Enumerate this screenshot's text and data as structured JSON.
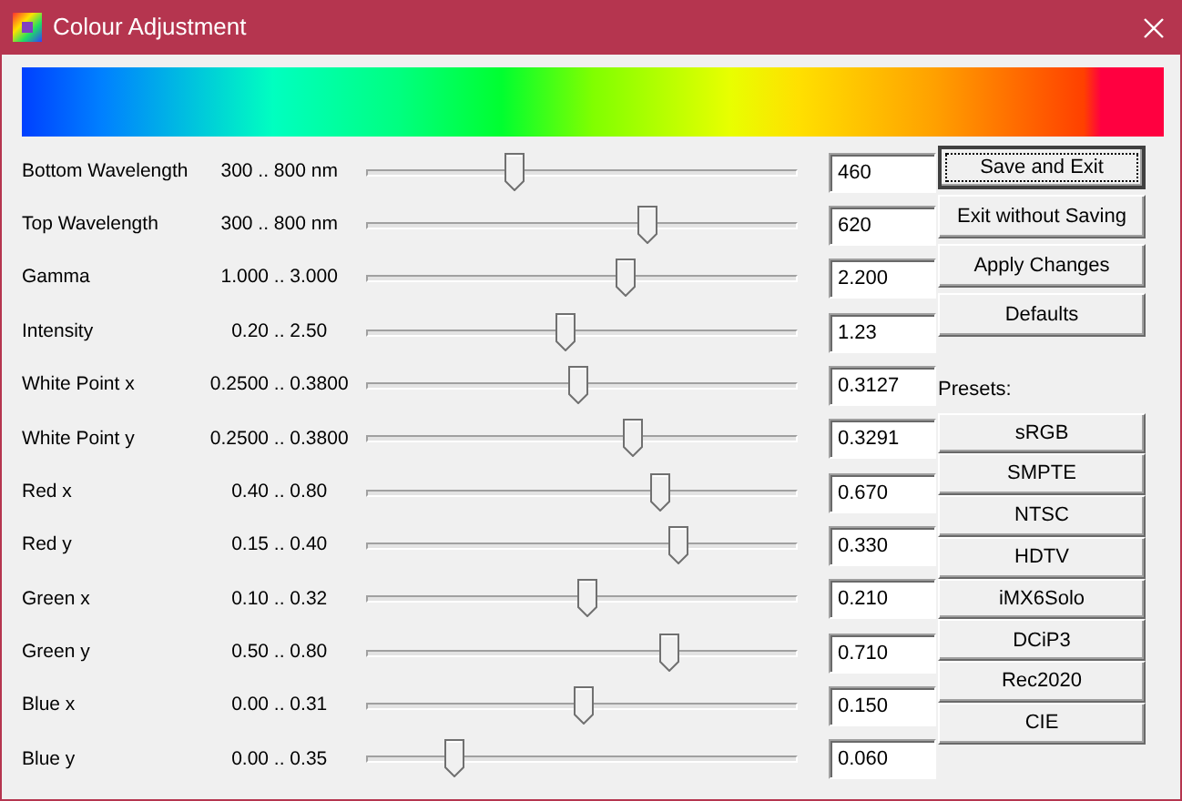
{
  "window": {
    "title": "Colour Adjustment"
  },
  "parameters": [
    {
      "name": "Bottom Wavelength",
      "range": "300 .. 800 nm",
      "level": 0.34,
      "value": "460"
    },
    {
      "name": "Top Wavelength",
      "range": "300 .. 800 nm",
      "level": 0.65,
      "value": "620"
    },
    {
      "name": "Gamma",
      "range": "1.000 .. 3.000",
      "level": 0.6,
      "value": "2.200"
    },
    {
      "name": "Intensity",
      "range": "0.20 .. 2.50",
      "level": 0.46,
      "value": "1.23"
    },
    {
      "name": "White Point x",
      "range": "0.2500 .. 0.3800",
      "level": 0.49,
      "value": "0.3127"
    },
    {
      "name": "White Point y",
      "range": "0.2500 .. 0.3800",
      "level": 0.615,
      "value": "0.3291"
    },
    {
      "name": "Red x",
      "range": "0.40 .. 0.80",
      "level": 0.68,
      "value": "0.670"
    },
    {
      "name": "Red y",
      "range": "0.15 .. 0.40",
      "level": 0.72,
      "value": "0.330"
    },
    {
      "name": "Green x",
      "range": "0.10 .. 0.32",
      "level": 0.51,
      "value": "0.210"
    },
    {
      "name": "Green y",
      "range": "0.50 .. 0.80",
      "level": 0.7,
      "value": "0.710"
    },
    {
      "name": "Blue x",
      "range": "0.00 .. 0.31",
      "level": 0.5,
      "value": "0.150"
    },
    {
      "name": "Blue y",
      "range": "0.00 .. 0.35",
      "level": 0.2,
      "value": "0.060"
    }
  ],
  "actions": [
    {
      "label": "Save and Exit",
      "default": true
    },
    {
      "label": "Exit without Saving",
      "default": false
    },
    {
      "label": "Apply Changes",
      "default": false
    },
    {
      "label": "Defaults",
      "default": false
    }
  ],
  "presets_label": "Presets:",
  "presets": [
    "sRGB",
    "SMPTE",
    "NTSC",
    "HDTV",
    "iMX6Solo",
    "DCiP3",
    "Rec2020",
    "CIE"
  ]
}
